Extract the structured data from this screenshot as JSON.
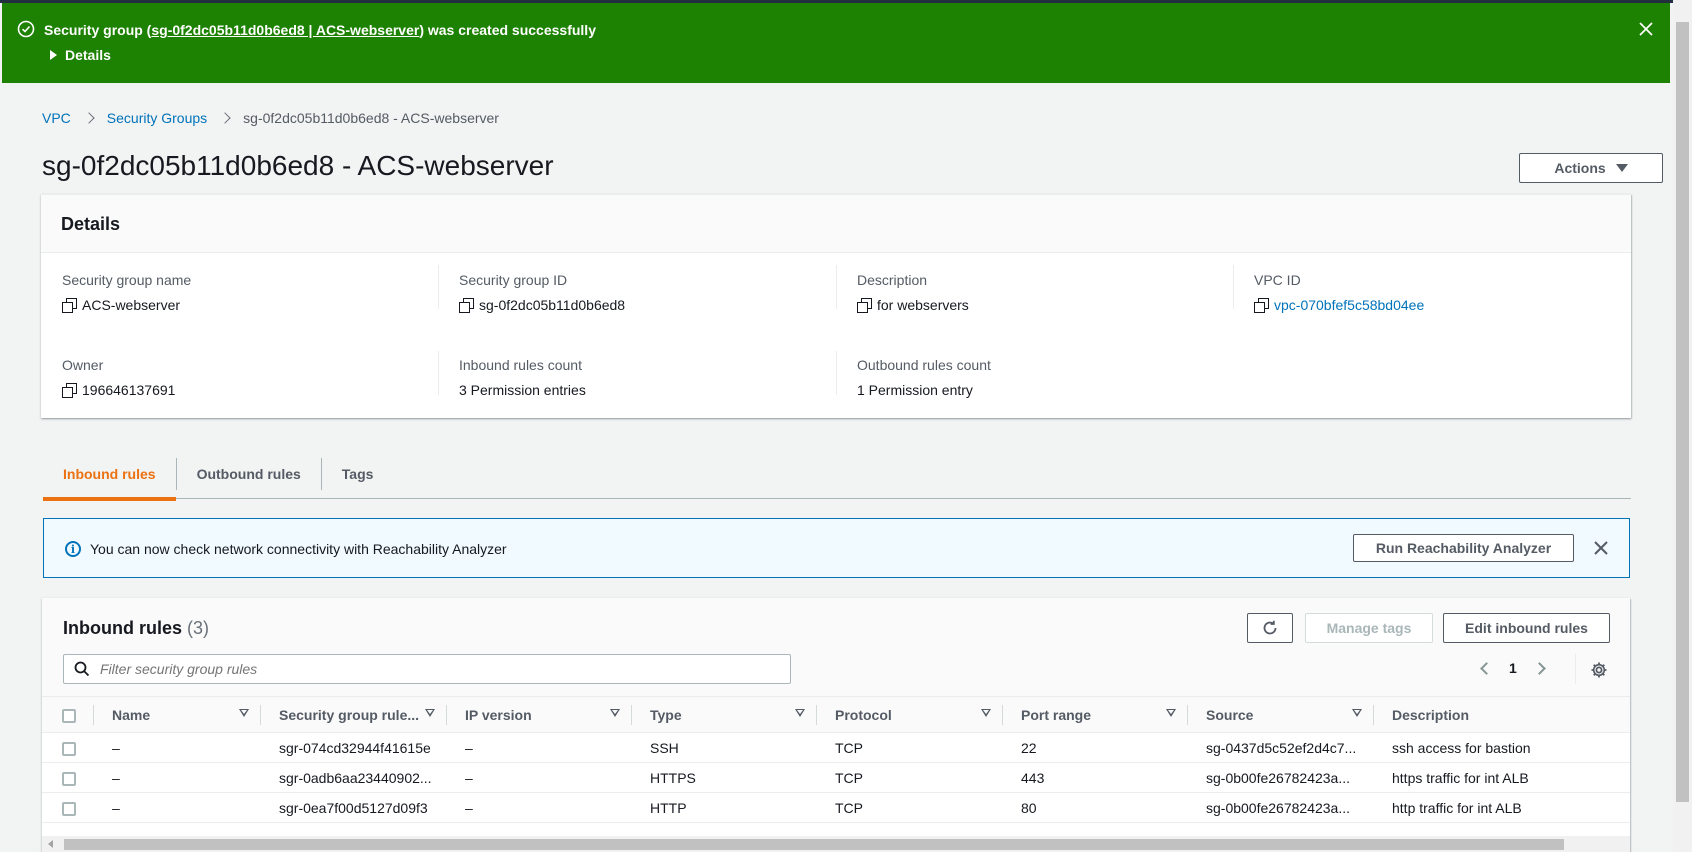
{
  "flash": {
    "prefix": "Security group (",
    "link": "sg-0f2dc05b11d0b6ed8 | ACS-webserver",
    "suffix": ") was created successfully",
    "details_label": "Details",
    "color": "#1d8102"
  },
  "breadcrumb": {
    "items": [
      "VPC",
      "Security Groups"
    ],
    "current": "sg-0f2dc05b11d0b6ed8 - ACS-webserver"
  },
  "page_title": "sg-0f2dc05b11d0b6ed8 - ACS-webserver",
  "actions_label": "Actions",
  "details": {
    "header": "Details",
    "fields": [
      {
        "label": "Security group name",
        "value": "ACS-webserver"
      },
      {
        "label": "Security group ID",
        "value": "sg-0f2dc05b11d0b6ed8"
      },
      {
        "label": "Description",
        "value": "for webservers"
      },
      {
        "label": "VPC ID",
        "value": "vpc-070bfef5c58bd04ee"
      },
      {
        "label": "Owner",
        "value": "196646137691"
      },
      {
        "label": "Inbound rules count",
        "value": "3 Permission entries"
      },
      {
        "label": "Outbound rules count",
        "value": "1 Permission entry"
      }
    ]
  },
  "tabs": [
    "Inbound rules",
    "Outbound rules",
    "Tags"
  ],
  "info_alert": {
    "text": "You can now check network connectivity with Reachability Analyzer",
    "button": "Run Reachability Analyzer"
  },
  "rules": {
    "title": "Inbound rules",
    "count": "(3)",
    "manage_tags": "Manage tags",
    "edit": "Edit inbound rules",
    "filter_placeholder": "Filter security group rules",
    "page": "1",
    "columns": [
      "Name",
      "Security group rule...",
      "IP version",
      "Type",
      "Protocol",
      "Port range",
      "Source",
      "Description"
    ],
    "rows": [
      [
        "–",
        "sgr-074cd32944f41615e",
        "–",
        "SSH",
        "TCP",
        "22",
        "sg-0437d5c52ef2d4c7...",
        "ssh access for bastion"
      ],
      [
        "–",
        "sgr-0adb6aa23440902...",
        "–",
        "HTTPS",
        "TCP",
        "443",
        "sg-0b00fe26782423a...",
        "https traffic for int ALB"
      ],
      [
        "–",
        "sgr-0ea7f00d5127d09f3",
        "–",
        "HTTP",
        "TCP",
        "80",
        "sg-0b00fe26782423a...",
        "http traffic for int ALB"
      ]
    ]
  },
  "accent": "#ec7211",
  "link_color": "#0073bb"
}
